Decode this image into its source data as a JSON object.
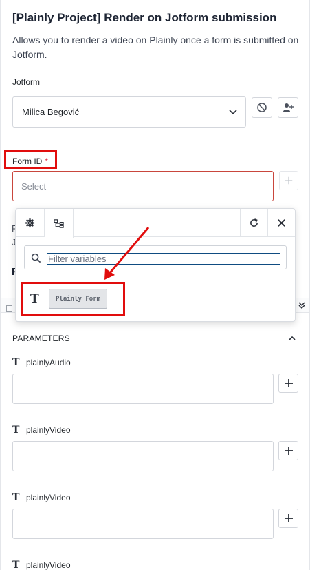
{
  "header": {
    "title": "[Plainly Project] Render on Jotform submission",
    "description": "Allows you to render a video on Plainly once a form is submitted on Jotform."
  },
  "connection": {
    "label": "Jotform",
    "selected_account": "Milica Begović"
  },
  "form_id": {
    "label": "Form ID",
    "required_marker": "*",
    "placeholder": "Select"
  },
  "background_fragments": {
    "line1": "F",
    "line2": "J",
    "line3": "F"
  },
  "variable_picker": {
    "filter_placeholder": "Filter variables",
    "items": [
      {
        "type_glyph": "T",
        "chip_label": "Plainly Form"
      }
    ]
  },
  "parameters": {
    "title": "PARAMETERS",
    "items": [
      {
        "type_glyph": "T",
        "name": "plainlyAudio",
        "value": ""
      },
      {
        "type_glyph": "T",
        "name": "plainlyVideo",
        "value": ""
      },
      {
        "type_glyph": "T",
        "name": "plainlyVideo",
        "value": ""
      },
      {
        "type_glyph": "T",
        "name": "plainlyVideo",
        "value": ""
      }
    ]
  },
  "colors": {
    "annotation_red": "#e10d0d",
    "required_red": "#e0334a",
    "error_border": "#c9463d",
    "focus_blue": "#0f4c81"
  },
  "icons": {
    "connection_disconnect": "ban-icon",
    "connection_add_user": "add-user-icon",
    "picker_settings": "gear-icon",
    "picker_tree": "tree-icon",
    "picker_refresh": "refresh-icon",
    "picker_close": "close-icon",
    "filter_search": "search-icon",
    "collapse": "chevron-up-icon"
  }
}
